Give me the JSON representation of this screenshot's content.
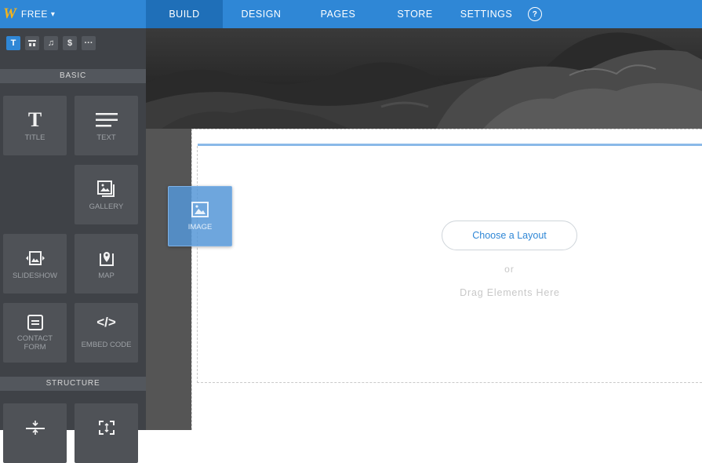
{
  "topbar": {
    "logo": "W",
    "plan": "FREE",
    "plan_chevron": "⌄",
    "nav": [
      {
        "label": "BUILD",
        "active": true
      },
      {
        "label": "DESIGN",
        "active": false
      },
      {
        "label": "PAGES",
        "active": false
      },
      {
        "label": "STORE",
        "active": false
      },
      {
        "label": "SETTINGS",
        "active": false
      }
    ],
    "help": "?"
  },
  "sidebar": {
    "tabs": [
      {
        "icon": "text-tab-icon",
        "glyph": "T"
      },
      {
        "icon": "layout-tab-icon",
        "glyph": "▬"
      },
      {
        "icon": "music-tab-icon",
        "glyph": "♫"
      },
      {
        "icon": "dollar-tab-icon",
        "glyph": "$"
      },
      {
        "icon": "more-tab-icon",
        "glyph": "···"
      }
    ],
    "basic_heading": "BASIC",
    "structure_heading": "STRUCTURE",
    "elements": {
      "title": "TITLE",
      "text": "TEXT",
      "gallery": "GALLERY",
      "slideshow": "SLIDESHOW",
      "map": "MAP",
      "contact_form_line1": "CONTACT",
      "contact_form_line2": "FORM",
      "embed_code": "EMBED CODE"
    }
  },
  "canvas": {
    "choose_layout": "Choose a Layout",
    "or": "or",
    "drag_elements": "Drag Elements Here"
  },
  "dragging": {
    "label": "IMAGE"
  },
  "colors": {
    "accent": "#2f87d6",
    "sidebar": "#3f4247",
    "logo": "#f7b41a"
  }
}
